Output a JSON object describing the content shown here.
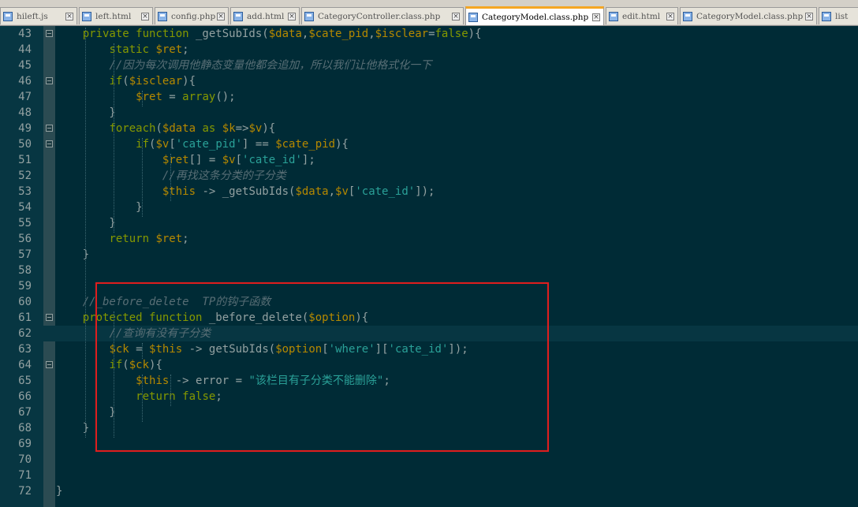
{
  "tabs": [
    {
      "label": "hileft.js",
      "active": false
    },
    {
      "label": "left.html",
      "active": false
    },
    {
      "label": "config.php",
      "active": false
    },
    {
      "label": "add.html",
      "active": false
    },
    {
      "label": "CategoryController.class.php",
      "active": false
    },
    {
      "label": "CategoryModel.class.php",
      "active": true
    },
    {
      "label": "edit.html",
      "active": false
    },
    {
      "label": "CategoryModel.class.php",
      "active": false
    },
    {
      "label": "list",
      "active": false
    }
  ],
  "tab_close_glyph": "×",
  "editor": {
    "theme_colors": {
      "background": "#002b36",
      "keyword": "#859900",
      "variable": "#b58900",
      "string": "#2aa198",
      "comment": "#586e75",
      "annotation_box": "#e01e1e"
    },
    "current_line": 62,
    "annotated_lines": [
      59,
      73
    ],
    "lines": [
      {
        "n": "43",
        "fold": true,
        "tokens": [
          [
            "plain",
            "    "
          ],
          [
            "kw",
            "private function"
          ],
          [
            "plain",
            " _getSubIds("
          ],
          [
            "var",
            "$data"
          ],
          [
            "plain",
            ","
          ],
          [
            "var",
            "$cate_pid"
          ],
          [
            "plain",
            ","
          ],
          [
            "var",
            "$isclear"
          ],
          [
            "plain",
            "="
          ],
          [
            "kw",
            "false"
          ],
          [
            "plain",
            "){"
          ]
        ]
      },
      {
        "n": "44",
        "fold": false,
        "tokens": [
          [
            "plain",
            "        "
          ],
          [
            "kw",
            "static"
          ],
          [
            "plain",
            " "
          ],
          [
            "var",
            "$ret"
          ],
          [
            "plain",
            ";"
          ]
        ]
      },
      {
        "n": "45",
        "fold": false,
        "tokens": [
          [
            "plain",
            "        "
          ],
          [
            "cmt",
            "//因为每次调用他静态变量他都会追加，所以我们让他格式化一下"
          ]
        ]
      },
      {
        "n": "46",
        "fold": true,
        "tokens": [
          [
            "plain",
            "        "
          ],
          [
            "kw",
            "if"
          ],
          [
            "plain",
            "("
          ],
          [
            "var",
            "$isclear"
          ],
          [
            "plain",
            "){"
          ]
        ]
      },
      {
        "n": "47",
        "fold": false,
        "tokens": [
          [
            "plain",
            "            "
          ],
          [
            "var",
            "$ret"
          ],
          [
            "plain",
            " = "
          ],
          [
            "kw",
            "array"
          ],
          [
            "plain",
            "();"
          ]
        ]
      },
      {
        "n": "48",
        "fold": false,
        "tokens": [
          [
            "plain",
            "        }"
          ]
        ]
      },
      {
        "n": "49",
        "fold": true,
        "tokens": [
          [
            "plain",
            "        "
          ],
          [
            "kw",
            "foreach"
          ],
          [
            "plain",
            "("
          ],
          [
            "var",
            "$data"
          ],
          [
            "plain",
            " "
          ],
          [
            "kw",
            "as"
          ],
          [
            "plain",
            " "
          ],
          [
            "var",
            "$k"
          ],
          [
            "plain",
            "=>"
          ],
          [
            "var",
            "$v"
          ],
          [
            "plain",
            "){"
          ]
        ]
      },
      {
        "n": "50",
        "fold": true,
        "tokens": [
          [
            "plain",
            "            "
          ],
          [
            "kw",
            "if"
          ],
          [
            "plain",
            "("
          ],
          [
            "var",
            "$v"
          ],
          [
            "plain",
            "["
          ],
          [
            "str",
            "'cate_pid'"
          ],
          [
            "plain",
            "] == "
          ],
          [
            "var",
            "$cate_pid"
          ],
          [
            "plain",
            "){"
          ]
        ]
      },
      {
        "n": "51",
        "fold": false,
        "tokens": [
          [
            "plain",
            "                "
          ],
          [
            "var",
            "$ret"
          ],
          [
            "plain",
            "[] = "
          ],
          [
            "var",
            "$v"
          ],
          [
            "plain",
            "["
          ],
          [
            "str",
            "'cate_id'"
          ],
          [
            "plain",
            "];"
          ]
        ]
      },
      {
        "n": "52",
        "fold": false,
        "tokens": [
          [
            "plain",
            "                "
          ],
          [
            "cmt",
            "//再找这条分类的子分类"
          ]
        ]
      },
      {
        "n": "53",
        "fold": false,
        "tokens": [
          [
            "plain",
            "                "
          ],
          [
            "var",
            "$this"
          ],
          [
            "plain",
            " -> _getSubIds("
          ],
          [
            "var",
            "$data"
          ],
          [
            "plain",
            ","
          ],
          [
            "var",
            "$v"
          ],
          [
            "plain",
            "["
          ],
          [
            "str",
            "'cate_id'"
          ],
          [
            "plain",
            "]);"
          ]
        ]
      },
      {
        "n": "54",
        "fold": false,
        "tokens": [
          [
            "plain",
            "            }"
          ]
        ]
      },
      {
        "n": "55",
        "fold": false,
        "tokens": [
          [
            "plain",
            "        }"
          ]
        ]
      },
      {
        "n": "56",
        "fold": false,
        "tokens": [
          [
            "plain",
            "        "
          ],
          [
            "kw",
            "return"
          ],
          [
            "plain",
            " "
          ],
          [
            "var",
            "$ret"
          ],
          [
            "plain",
            ";"
          ]
        ]
      },
      {
        "n": "57",
        "fold": false,
        "tokens": [
          [
            "plain",
            "    }"
          ]
        ]
      },
      {
        "n": "58",
        "fold": false,
        "tokens": []
      },
      {
        "n": "59",
        "fold": false,
        "tokens": []
      },
      {
        "n": "60",
        "fold": false,
        "tokens": [
          [
            "plain",
            "    "
          ],
          [
            "cmt",
            "//_before_delete  TP的钩子函数"
          ]
        ]
      },
      {
        "n": "61",
        "fold": true,
        "tokens": [
          [
            "plain",
            "    "
          ],
          [
            "kw",
            "protected function"
          ],
          [
            "plain",
            " _before_delete("
          ],
          [
            "var",
            "$option"
          ],
          [
            "plain",
            "){"
          ]
        ]
      },
      {
        "n": "62",
        "fold": false,
        "tokens": [
          [
            "plain",
            "        "
          ],
          [
            "cmt",
            "//查询有没有子分类"
          ]
        ]
      },
      {
        "n": "63",
        "fold": false,
        "tokens": [
          [
            "plain",
            "        "
          ],
          [
            "var",
            "$ck"
          ],
          [
            "plain",
            " = "
          ],
          [
            "var",
            "$this"
          ],
          [
            "plain",
            " -> getSubIds("
          ],
          [
            "var",
            "$option"
          ],
          [
            "plain",
            "["
          ],
          [
            "str",
            "'where'"
          ],
          [
            "plain",
            "]["
          ],
          [
            "str",
            "'cate_id'"
          ],
          [
            "plain",
            "]);"
          ]
        ]
      },
      {
        "n": "64",
        "fold": true,
        "tokens": [
          [
            "plain",
            "        "
          ],
          [
            "kw",
            "if"
          ],
          [
            "plain",
            "("
          ],
          [
            "var",
            "$ck"
          ],
          [
            "plain",
            "){"
          ]
        ]
      },
      {
        "n": "65",
        "fold": false,
        "tokens": [
          [
            "plain",
            "            "
          ],
          [
            "var",
            "$this"
          ],
          [
            "plain",
            " -> error = "
          ],
          [
            "str",
            "\"该栏目有子分类不能删除\""
          ],
          [
            "plain",
            ";"
          ]
        ]
      },
      {
        "n": "66",
        "fold": false,
        "tokens": [
          [
            "plain",
            "            "
          ],
          [
            "kw",
            "return false"
          ],
          [
            "plain",
            ";"
          ]
        ]
      },
      {
        "n": "67",
        "fold": false,
        "tokens": [
          [
            "plain",
            "        }"
          ]
        ]
      },
      {
        "n": "68",
        "fold": false,
        "tokens": [
          [
            "plain",
            "    }"
          ]
        ]
      },
      {
        "n": "69",
        "fold": false,
        "tokens": []
      },
      {
        "n": "70",
        "fold": false,
        "tokens": []
      },
      {
        "n": "71",
        "fold": false,
        "tokens": []
      },
      {
        "n": "72",
        "fold": false,
        "tokens": [
          [
            "plain",
            "}"
          ]
        ]
      }
    ]
  }
}
